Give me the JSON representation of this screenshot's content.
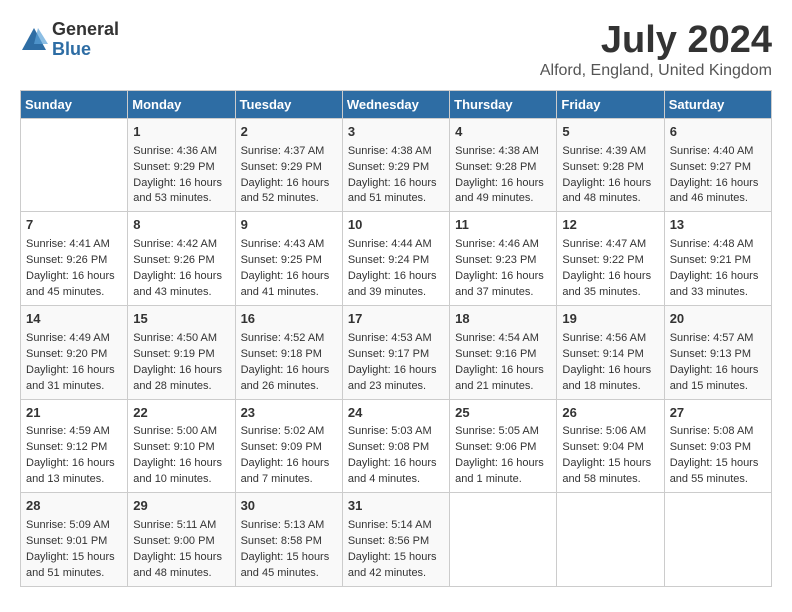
{
  "logo": {
    "general": "General",
    "blue": "Blue"
  },
  "title": "July 2024",
  "location": "Alford, England, United Kingdom",
  "days_of_week": [
    "Sunday",
    "Monday",
    "Tuesday",
    "Wednesday",
    "Thursday",
    "Friday",
    "Saturday"
  ],
  "weeks": [
    [
      {
        "day": "",
        "content": ""
      },
      {
        "day": "1",
        "content": "Sunrise: 4:36 AM\nSunset: 9:29 PM\nDaylight: 16 hours\nand 53 minutes."
      },
      {
        "day": "2",
        "content": "Sunrise: 4:37 AM\nSunset: 9:29 PM\nDaylight: 16 hours\nand 52 minutes."
      },
      {
        "day": "3",
        "content": "Sunrise: 4:38 AM\nSunset: 9:29 PM\nDaylight: 16 hours\nand 51 minutes."
      },
      {
        "day": "4",
        "content": "Sunrise: 4:38 AM\nSunset: 9:28 PM\nDaylight: 16 hours\nand 49 minutes."
      },
      {
        "day": "5",
        "content": "Sunrise: 4:39 AM\nSunset: 9:28 PM\nDaylight: 16 hours\nand 48 minutes."
      },
      {
        "day": "6",
        "content": "Sunrise: 4:40 AM\nSunset: 9:27 PM\nDaylight: 16 hours\nand 46 minutes."
      }
    ],
    [
      {
        "day": "7",
        "content": "Sunrise: 4:41 AM\nSunset: 9:26 PM\nDaylight: 16 hours\nand 45 minutes."
      },
      {
        "day": "8",
        "content": "Sunrise: 4:42 AM\nSunset: 9:26 PM\nDaylight: 16 hours\nand 43 minutes."
      },
      {
        "day": "9",
        "content": "Sunrise: 4:43 AM\nSunset: 9:25 PM\nDaylight: 16 hours\nand 41 minutes."
      },
      {
        "day": "10",
        "content": "Sunrise: 4:44 AM\nSunset: 9:24 PM\nDaylight: 16 hours\nand 39 minutes."
      },
      {
        "day": "11",
        "content": "Sunrise: 4:46 AM\nSunset: 9:23 PM\nDaylight: 16 hours\nand 37 minutes."
      },
      {
        "day": "12",
        "content": "Sunrise: 4:47 AM\nSunset: 9:22 PM\nDaylight: 16 hours\nand 35 minutes."
      },
      {
        "day": "13",
        "content": "Sunrise: 4:48 AM\nSunset: 9:21 PM\nDaylight: 16 hours\nand 33 minutes."
      }
    ],
    [
      {
        "day": "14",
        "content": "Sunrise: 4:49 AM\nSunset: 9:20 PM\nDaylight: 16 hours\nand 31 minutes."
      },
      {
        "day": "15",
        "content": "Sunrise: 4:50 AM\nSunset: 9:19 PM\nDaylight: 16 hours\nand 28 minutes."
      },
      {
        "day": "16",
        "content": "Sunrise: 4:52 AM\nSunset: 9:18 PM\nDaylight: 16 hours\nand 26 minutes."
      },
      {
        "day": "17",
        "content": "Sunrise: 4:53 AM\nSunset: 9:17 PM\nDaylight: 16 hours\nand 23 minutes."
      },
      {
        "day": "18",
        "content": "Sunrise: 4:54 AM\nSunset: 9:16 PM\nDaylight: 16 hours\nand 21 minutes."
      },
      {
        "day": "19",
        "content": "Sunrise: 4:56 AM\nSunset: 9:14 PM\nDaylight: 16 hours\nand 18 minutes."
      },
      {
        "day": "20",
        "content": "Sunrise: 4:57 AM\nSunset: 9:13 PM\nDaylight: 16 hours\nand 15 minutes."
      }
    ],
    [
      {
        "day": "21",
        "content": "Sunrise: 4:59 AM\nSunset: 9:12 PM\nDaylight: 16 hours\nand 13 minutes."
      },
      {
        "day": "22",
        "content": "Sunrise: 5:00 AM\nSunset: 9:10 PM\nDaylight: 16 hours\nand 10 minutes."
      },
      {
        "day": "23",
        "content": "Sunrise: 5:02 AM\nSunset: 9:09 PM\nDaylight: 16 hours\nand 7 minutes."
      },
      {
        "day": "24",
        "content": "Sunrise: 5:03 AM\nSunset: 9:08 PM\nDaylight: 16 hours\nand 4 minutes."
      },
      {
        "day": "25",
        "content": "Sunrise: 5:05 AM\nSunset: 9:06 PM\nDaylight: 16 hours\nand 1 minute."
      },
      {
        "day": "26",
        "content": "Sunrise: 5:06 AM\nSunset: 9:04 PM\nDaylight: 15 hours\nand 58 minutes."
      },
      {
        "day": "27",
        "content": "Sunrise: 5:08 AM\nSunset: 9:03 PM\nDaylight: 15 hours\nand 55 minutes."
      }
    ],
    [
      {
        "day": "28",
        "content": "Sunrise: 5:09 AM\nSunset: 9:01 PM\nDaylight: 15 hours\nand 51 minutes."
      },
      {
        "day": "29",
        "content": "Sunrise: 5:11 AM\nSunset: 9:00 PM\nDaylight: 15 hours\nand 48 minutes."
      },
      {
        "day": "30",
        "content": "Sunrise: 5:13 AM\nSunset: 8:58 PM\nDaylight: 15 hours\nand 45 minutes."
      },
      {
        "day": "31",
        "content": "Sunrise: 5:14 AM\nSunset: 8:56 PM\nDaylight: 15 hours\nand 42 minutes."
      },
      {
        "day": "",
        "content": ""
      },
      {
        "day": "",
        "content": ""
      },
      {
        "day": "",
        "content": ""
      }
    ]
  ]
}
